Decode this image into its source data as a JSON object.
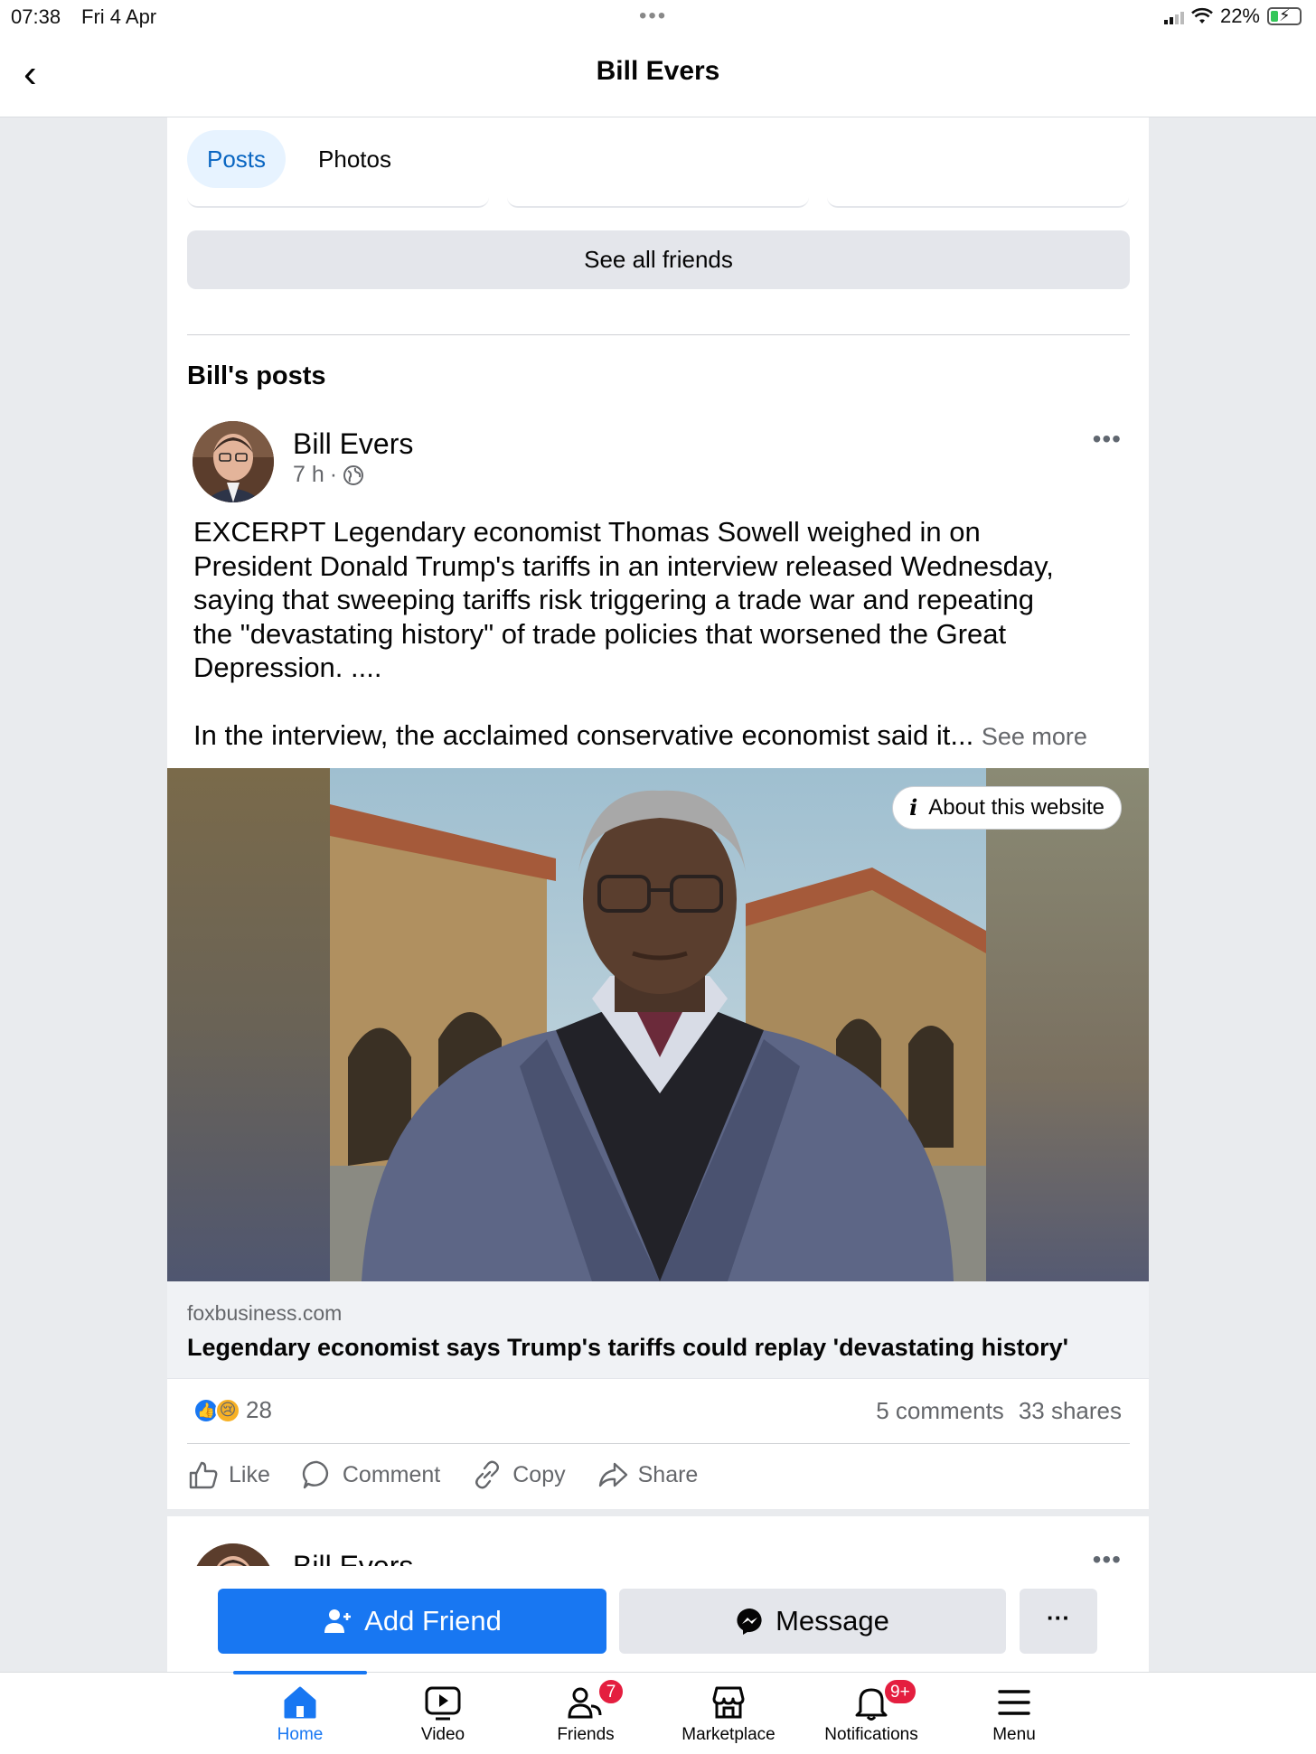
{
  "status_bar": {
    "time": "07:38",
    "date": "Fri 4 Apr",
    "battery": "22%"
  },
  "header": {
    "title": "Bill Evers"
  },
  "tabs": [
    {
      "label": "Posts",
      "active": true
    },
    {
      "label": "Photos",
      "active": false
    }
  ],
  "friends": {
    "see_all_label": "See all friends"
  },
  "section": {
    "title": "Bill's posts"
  },
  "post": {
    "author": "Bill Evers",
    "time": "7 h",
    "separator": "·",
    "text_lines": [
      "EXCERPT Legendary economist Thomas Sowell weighed in on",
      "President Donald Trump's tariffs in an interview released Wednesday,",
      "saying that sweeping tariffs risk triggering a trade war and repeating",
      "the \"devastating history\" of trade policies that worsened the Great",
      "Depression. ...."
    ],
    "text_second": "In the interview, the acclaimed conservative economist said it...",
    "see_more": "See more",
    "about_website": "About this website",
    "link_domain": "foxbusiness.com",
    "link_title": "Legendary economist says Trump's tariffs could replay 'devastating history'",
    "reaction_count": "28",
    "comments": "5 comments",
    "shares": "33 shares",
    "actions": {
      "like": "Like",
      "comment": "Comment",
      "copy": "Copy",
      "share": "Share"
    }
  },
  "next_post": {
    "author": "Bill Evers"
  },
  "profile_actions": {
    "add_friend": "Add Friend",
    "message": "Message",
    "more": "···"
  },
  "bottom_nav": {
    "home": "Home",
    "video": "Video",
    "friends": "Friends",
    "friends_badge": "7",
    "marketplace": "Marketplace",
    "notifications": "Notifications",
    "notifications_badge": "9+",
    "menu": "Menu"
  },
  "colors": {
    "accent": "#1877f2",
    "badge": "#e41e3f",
    "tab_active_bg": "#e7f3ff"
  }
}
